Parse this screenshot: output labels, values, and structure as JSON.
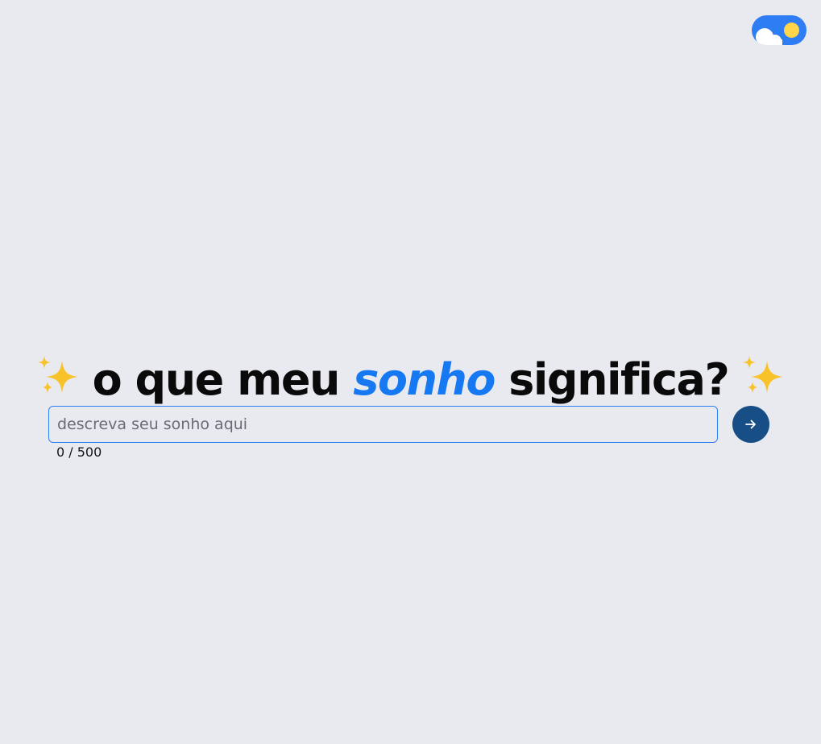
{
  "theme_toggle": {
    "state": "light",
    "icons": [
      "cloud-icon",
      "sun-icon"
    ],
    "colors": {
      "track": "#2f7df3",
      "sun": "#ffd54a",
      "cloud": "#ffffff"
    }
  },
  "headline": {
    "sparkle_icon": "sparkles-emoji",
    "before": "o que meu",
    "accent": "sonho",
    "after": "significa?",
    "colors": {
      "text": "#0a0a0a",
      "accent": "#1679f2"
    }
  },
  "dream_form": {
    "placeholder": "descreva seu sonho aqui",
    "value": "",
    "counter": "0 / 500",
    "submit_icon": "arrow-right-icon",
    "colors": {
      "input_border": "#2f7df3",
      "submit_bg": "#164e85"
    }
  },
  "page": {
    "background": "#e9eaf0"
  }
}
